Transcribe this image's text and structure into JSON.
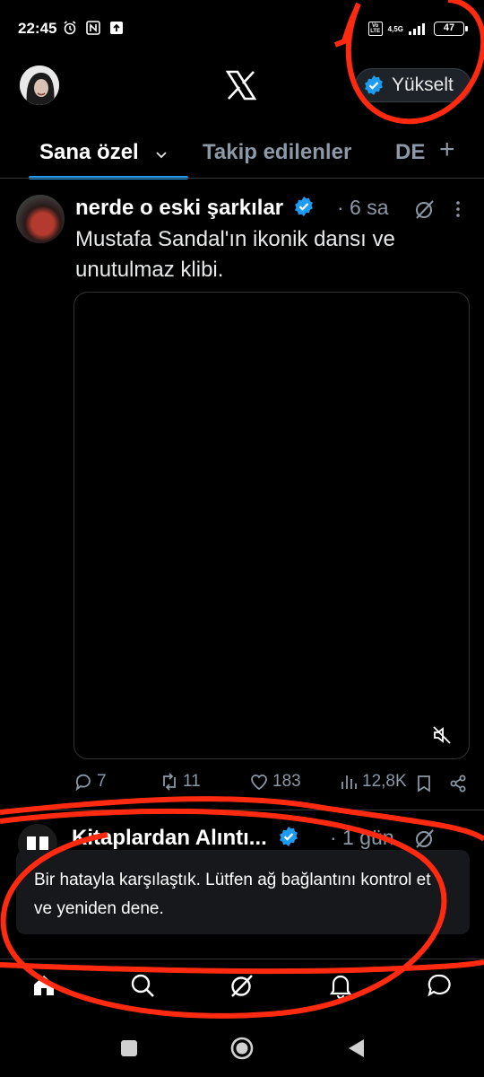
{
  "status_bar": {
    "time": "22:45",
    "network": "4,5G",
    "volte": "Vo LTE",
    "battery": "47"
  },
  "header": {
    "logo": "x-logo-icon",
    "upgrade_label": "Yükselt"
  },
  "tabs": {
    "active": "Sana özel",
    "items": [
      "Takip edilenler",
      "DE"
    ],
    "add": "+"
  },
  "post1": {
    "author": "nerde o eski şarkılar",
    "time": "· 6 sa",
    "text": "Mustafa Sandal'ın ikonik dansı ve unutulmaz klibi.",
    "replies": "7",
    "reposts": "11",
    "likes": "183",
    "views": "12,8K"
  },
  "post2": {
    "author": "Kitaplardan Alıntı...",
    "time": "· 1 gün"
  },
  "toast": {
    "message": "Bir hatayla karşılaştık. Lütfen ağ bağlantını kontrol et ve yeniden dene."
  },
  "colors": {
    "accent": "#1d9bf0",
    "annotation": "#ff2a10",
    "muted": "#8b98a5"
  }
}
